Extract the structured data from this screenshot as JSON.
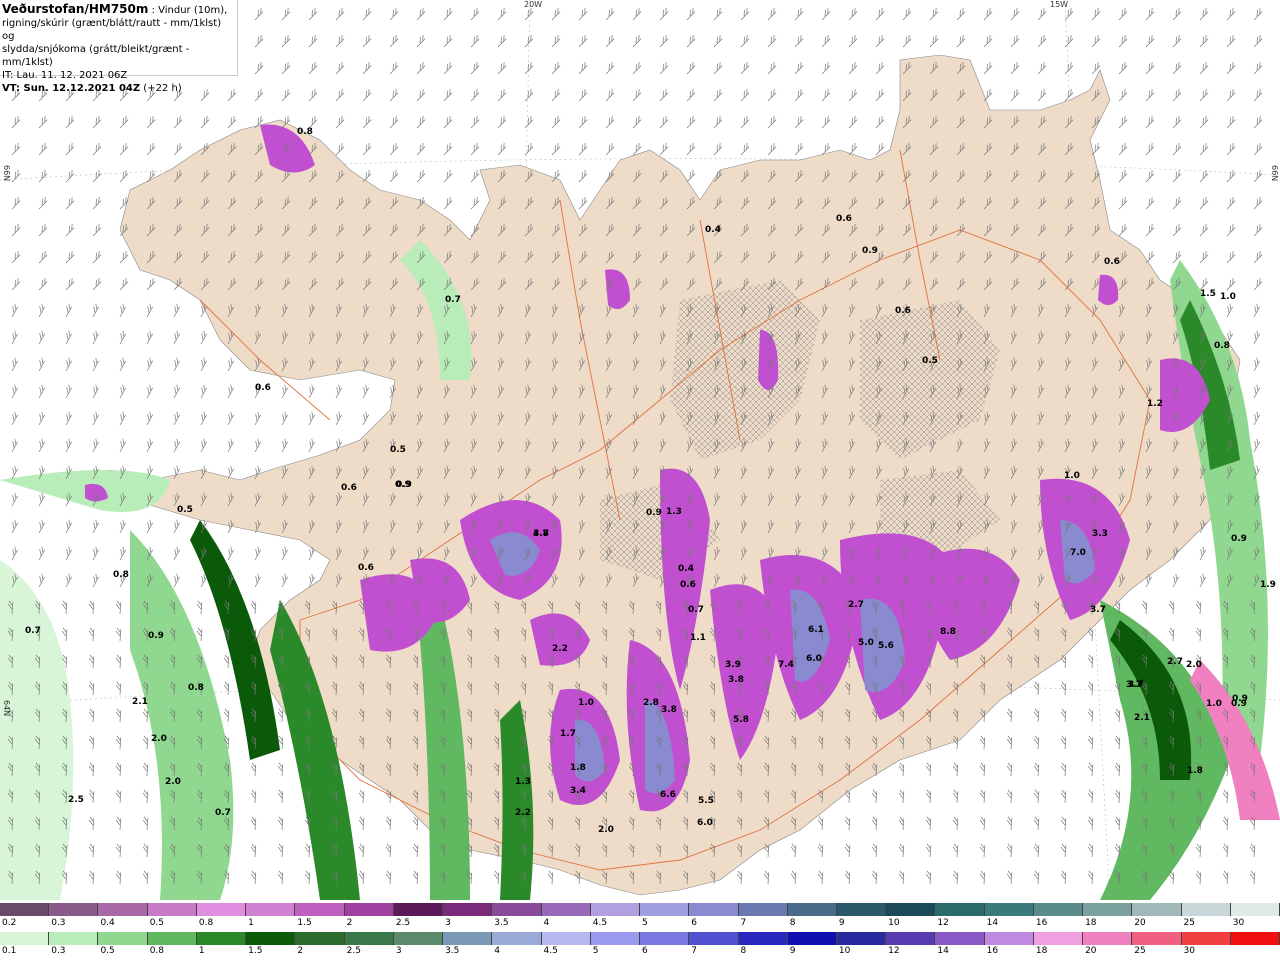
{
  "header": {
    "title_bold": "Veðurstofan/HM750m",
    "title_rest": " : Vindur (10m),",
    "line2": "rigning/skúrir (grænt/blátt/rautt - mm/1klst) og",
    "line3": "slydda/snjókoma (grátt/bleikt/grænt - mm/1klst)",
    "it_line": "IT: Lau. 11. 12. 2021 06Z",
    "vt_label": "VT: Sun. 12.12.2021 04Z",
    "vt_offset": " (+22 h)"
  },
  "graticule": {
    "lon_labels": [
      "20W",
      "15W"
    ],
    "lat_labels": [
      "66N",
      "64N"
    ]
  },
  "value_labels": [
    "0.8",
    "0.7",
    "0.6",
    "0.5",
    "0.9",
    "0.8",
    "0.7",
    "0.9",
    "0.8",
    "2.1",
    "2.0",
    "2.0",
    "2.5",
    "0.7",
    "0.6",
    "0.5",
    "0.6",
    "0.9",
    "1.3",
    "2.2",
    "3.4",
    "2.0",
    "1.8",
    "6.6",
    "5.5",
    "6.0",
    "4.8",
    "3.7",
    "1.3",
    "0.9",
    "0.4",
    "0.6",
    "0.7",
    "1.1",
    "2.2",
    "1.0",
    "1.7",
    "2.8",
    "3.8",
    "3.9",
    "3.8",
    "5.8",
    "7.4",
    "6.0",
    "6.1",
    "2.7",
    "5.0",
    "5.6",
    "8.8",
    "7.0",
    "1.0",
    "3.3",
    "3.7",
    "2.7",
    "2.0",
    "3.7",
    "1.0",
    "0.9",
    "1.5",
    "1.0",
    "0.8",
    "0.6",
    "0.9",
    "0.4",
    "0.6",
    "0.5",
    "0.6",
    "1.2",
    "0.9",
    "1.9",
    "0.9",
    "3.7",
    "2.1",
    "1.8"
  ],
  "legend_top": {
    "colors": [
      "#6a4a6a",
      "#8a5a8a",
      "#a868a8",
      "#c77ac7",
      "#e08ee0",
      "#d080d0",
      "#c060c0",
      "#a040a0",
      "#5a1a5a",
      "#7a2a7a",
      "#8a4a9a",
      "#9a6aba",
      "#b0a0e0",
      "#a0a0e0",
      "#8a8ad0",
      "#6a7ab0",
      "#4a6a8a",
      "#2a5a6a",
      "#1a4a5a",
      "#2a6a6a",
      "#3a7a7a",
      "#5a8a8a",
      "#7aa0a0",
      "#a0b8b8",
      "#c8d8d8",
      "#e0e8e8"
    ],
    "ticks": [
      "0.2",
      "0.3",
      "0.4",
      "0.5",
      "0.8",
      "1",
      "1.5",
      "2",
      "2.5",
      "3",
      "3.5",
      "4",
      "4.5",
      "5",
      "6",
      "7",
      "8",
      "9",
      "10",
      "12",
      "14",
      "16",
      "18",
      "20",
      "25",
      "30"
    ]
  },
  "legend_bottom": {
    "colors": [
      "#d8f5d8",
      "#b8ecb8",
      "#90d890",
      "#60b860",
      "#2a8a2a",
      "#0a5a0a",
      "#2a6a2a",
      "#3a7a4a",
      "#5a8a6a",
      "#7a9ab8",
      "#9aaad8",
      "#b8b8f0",
      "#9a9af0",
      "#7878e0",
      "#5050d0",
      "#2828c0",
      "#1010b0",
      "#2a2aa0",
      "#5a3ab0",
      "#8a5ac8",
      "#c08ae0",
      "#f0a0e0",
      "#f080c0",
      "#f06080",
      "#f04040",
      "#f01010"
    ],
    "ticks": [
      "0.1",
      "0.3",
      "0.5",
      "0.8",
      "1",
      "1.5",
      "2",
      "2.5",
      "3",
      "3.5",
      "4",
      "4.5",
      "5",
      "6",
      "7",
      "8",
      "9",
      "10",
      "12",
      "14",
      "16",
      "18",
      "20",
      "25",
      "30"
    ]
  },
  "colors": {
    "land": "#efdcc8",
    "sea": "#ffffff",
    "roads": "#e07040",
    "snow_light": "#b8ecb8",
    "snow_mid": "#2a8a2a",
    "snow_dark": "#0a5a0a",
    "precip_purple": "#c050d0",
    "precip_blue": "#8a8ad0"
  }
}
